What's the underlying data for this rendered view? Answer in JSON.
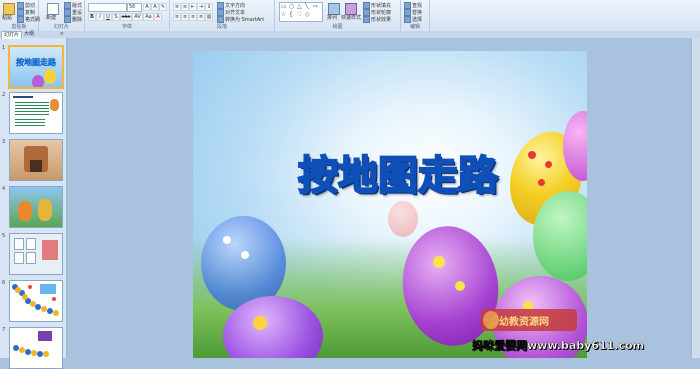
{
  "ribbon": {
    "groups": [
      {
        "label": "剪贴板"
      },
      {
        "label": "幻灯片"
      },
      {
        "label": "字体"
      },
      {
        "label": "段落"
      },
      {
        "label": "绘图"
      },
      {
        "label": "编辑"
      }
    ],
    "clipboard": {
      "paste": "粘贴",
      "cut": "剪切",
      "copy": "复制",
      "painter": "格式刷"
    },
    "slides": {
      "new": "新建",
      "new2": "幻灯片",
      "layout": "版式",
      "reset": "重设",
      "delete": "删除"
    },
    "font": {
      "name": "",
      "size": "56",
      "bold": "B",
      "italic": "I",
      "underline": "U",
      "shadow": "S",
      "strike": "abc",
      "spacing": "AV",
      "case": "Aa",
      "color": "A"
    },
    "paragraph": {
      "direction": "文字方向",
      "align": "对齐文本",
      "smartart": "转换为 SmartArt"
    },
    "drawing": {
      "arrange": "排列",
      "quickstyle": "快速样式",
      "fill": "形状填充",
      "outline": "形状轮廓",
      "effect": "形状效果"
    },
    "editing": {
      "find": "查找",
      "replace": "替换",
      "select": "选择"
    }
  },
  "panel": {
    "tab_outline": "幻灯片",
    "tab_slides": "大纲",
    "close": "×",
    "slides": [
      {
        "num": "1",
        "title": "按地图走路"
      },
      {
        "num": "2"
      },
      {
        "num": "3"
      },
      {
        "num": "4"
      },
      {
        "num": "5"
      },
      {
        "num": "6"
      },
      {
        "num": "7"
      }
    ]
  },
  "slide": {
    "title": "按地图走路"
  },
  "watermark": {
    "logo_text": "幼教资源网",
    "site": "妈咪爱婴网www.baby611.com"
  }
}
